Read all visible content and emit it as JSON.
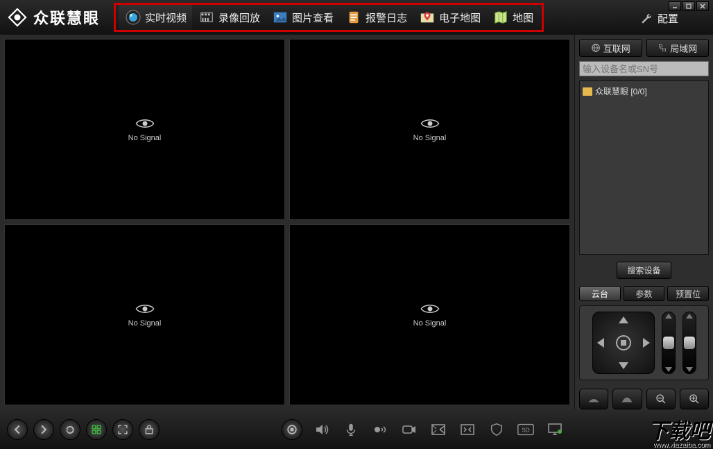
{
  "app": {
    "title": "众联慧眼"
  },
  "nav": {
    "items": [
      {
        "label": "实时视频",
        "icon": "camera-lens"
      },
      {
        "label": "录像回放",
        "icon": "film"
      },
      {
        "label": "图片查看",
        "icon": "image"
      },
      {
        "label": "报警日志",
        "icon": "clipboard"
      },
      {
        "label": "电子地图",
        "icon": "emap"
      },
      {
        "label": "地图",
        "icon": "map"
      }
    ],
    "settings_label": "配置"
  },
  "video": {
    "no_signal": "No Signal"
  },
  "side": {
    "net_tabs": {
      "internet": "互联网",
      "lan": "局域网"
    },
    "search_placeholder": "输入设备名或SN号",
    "tree_root": "众联慧眼 [0/0]",
    "search_btn": "搜索设备",
    "ptz_tabs": {
      "ptz": "云台",
      "param": "参数",
      "preset": "预置位"
    }
  },
  "watermark": {
    "big": "下载吧",
    "url": "www.xiazaiba.com"
  }
}
